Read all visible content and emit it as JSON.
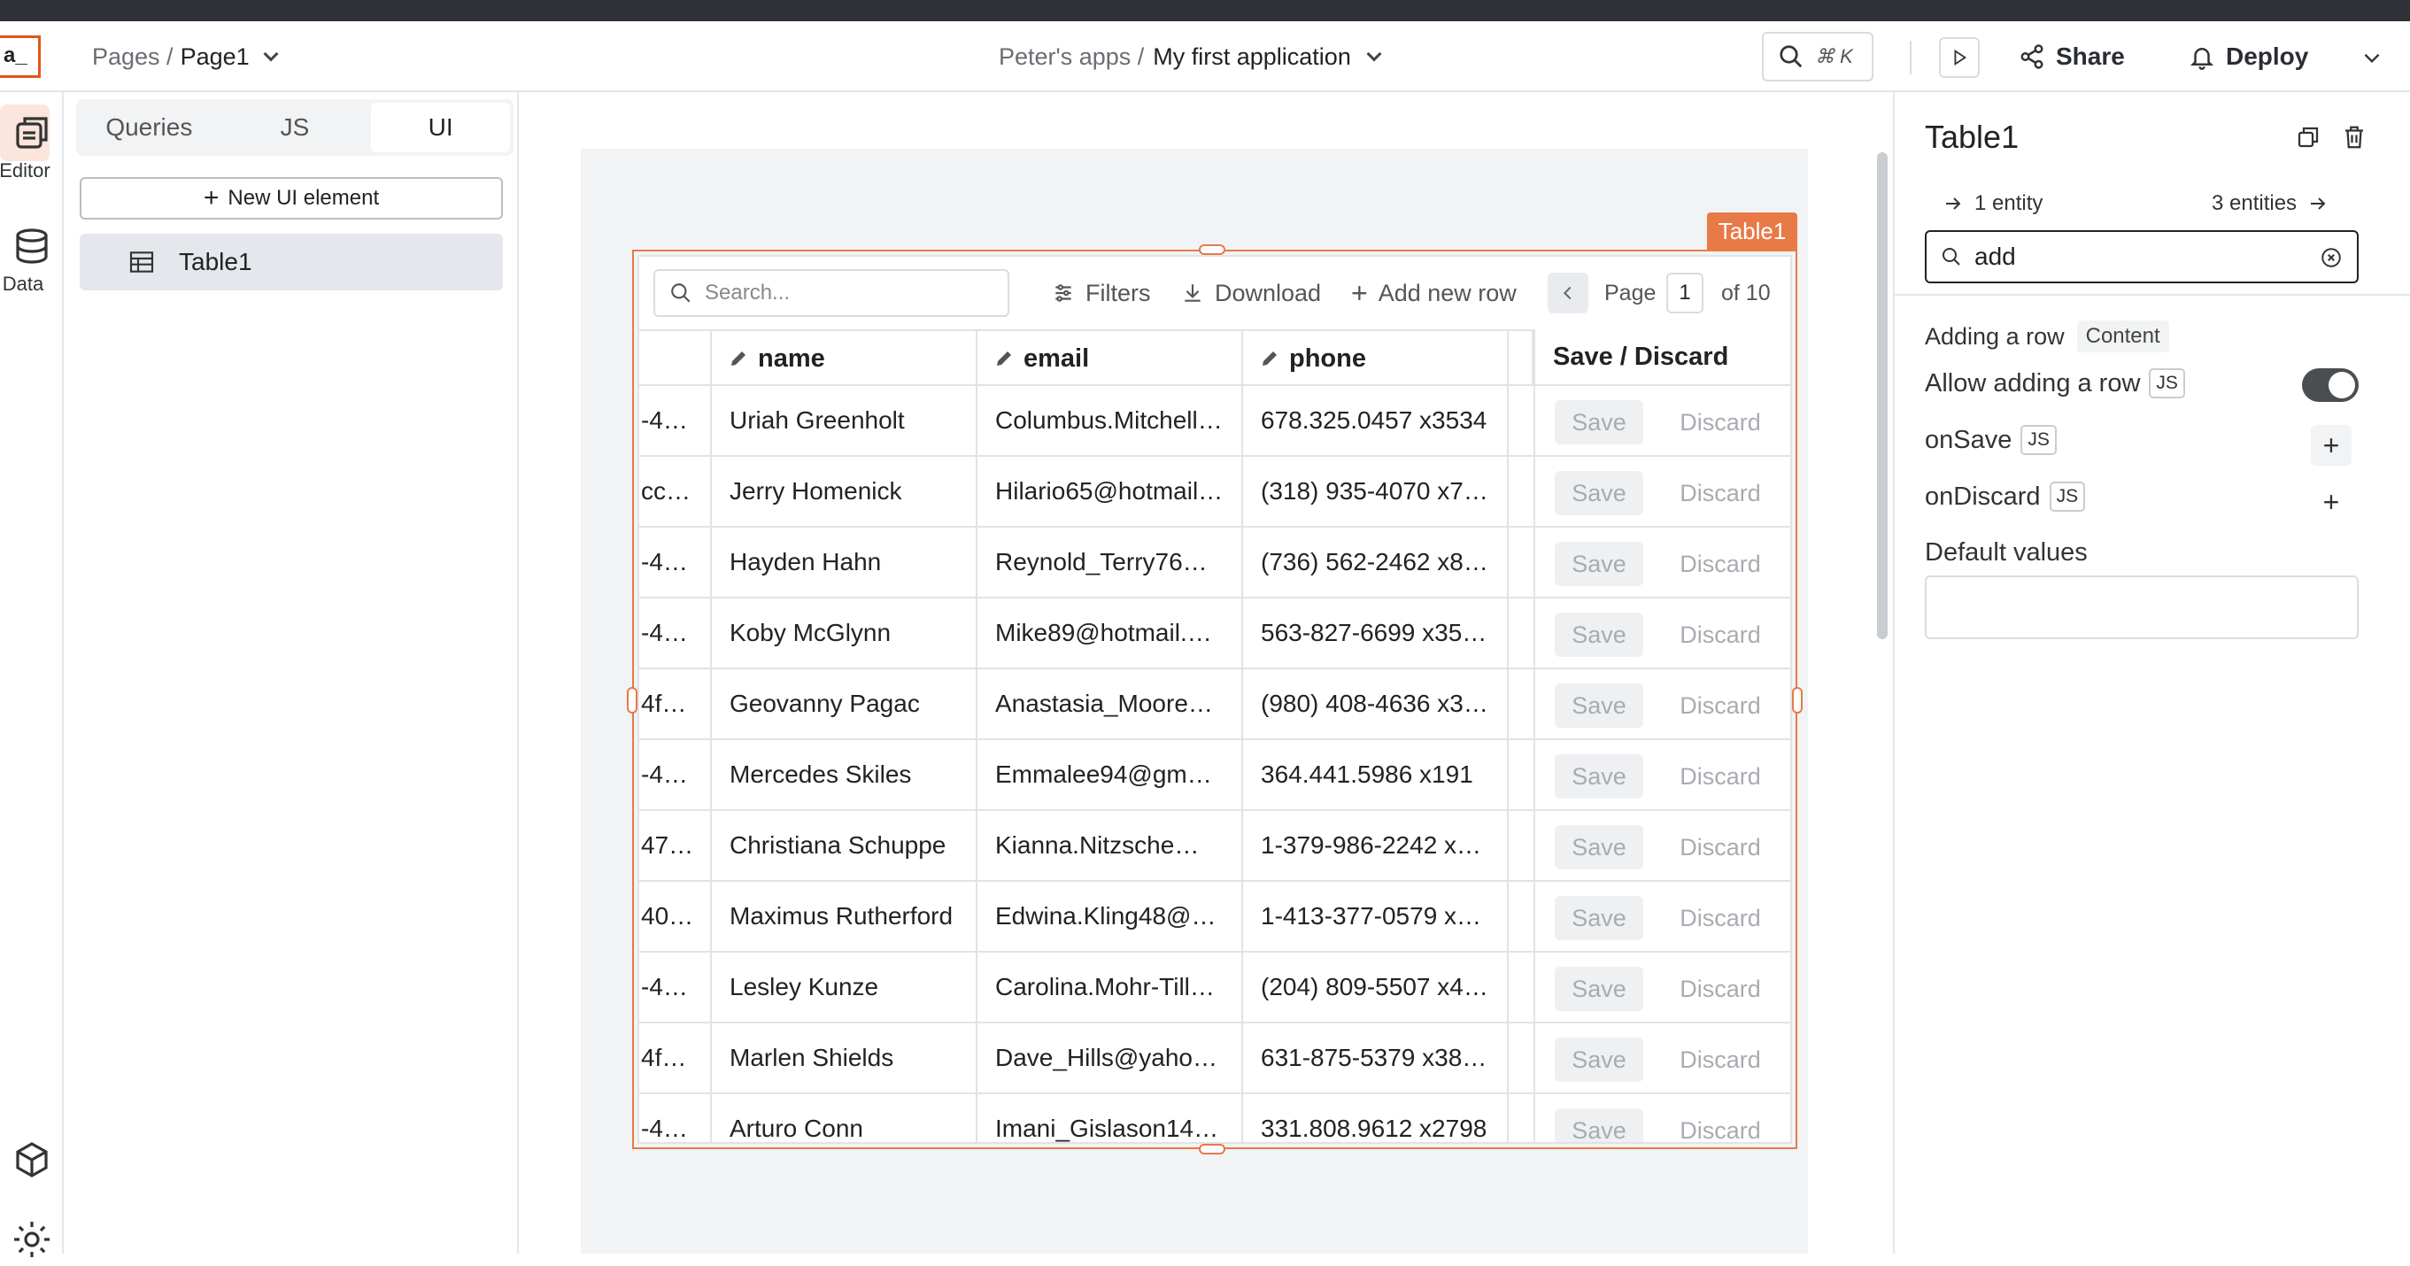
{
  "header": {
    "logo": "a_",
    "pages_label": "Pages /",
    "page_name": "Page1",
    "workspace": "Peter's apps /",
    "app_name": "My first application",
    "search_shortcut": "⌘ K",
    "share_label": "Share",
    "deploy_label": "Deploy"
  },
  "rail": {
    "editor_label": "Editor",
    "data_label": "Data"
  },
  "explorer": {
    "tabs": [
      {
        "label": "Queries"
      },
      {
        "label": "JS"
      },
      {
        "label": "UI"
      }
    ],
    "active_tab": "UI",
    "new_ui_label": "New UI element",
    "entity_name": "Table1"
  },
  "widget": {
    "label": "Table1"
  },
  "table": {
    "search_placeholder": "Search...",
    "filters_label": "Filters",
    "download_label": "Download",
    "add_row_label": "Add new row",
    "page_label": "Page",
    "page_number": "1",
    "page_of": "of 10",
    "columns": [
      "name",
      "email",
      "phone"
    ],
    "action_header": "Save / Discard",
    "save_label": "Save",
    "discard_label": "Discard",
    "rows": [
      {
        "id": "-4…",
        "name": "Uriah Greenholt",
        "email": "Columbus.Mitchell…",
        "phone": "678.325.0457 x3534"
      },
      {
        "id": "cc…",
        "name": "Jerry Homenick",
        "email": "Hilario65@hotmail…",
        "phone": "(318) 935-4070 x7…"
      },
      {
        "id": "-4…",
        "name": "Hayden Hahn",
        "email": "Reynold_Terry76…",
        "phone": "(736) 562-2462 x8…"
      },
      {
        "id": "-4…",
        "name": "Koby McGlynn",
        "email": "Mike89@hotmail.…",
        "phone": "563-827-6699 x35…"
      },
      {
        "id": "4f…",
        "name": "Geovanny Pagac",
        "email": "Anastasia_Moore…",
        "phone": "(980) 408-4636 x3…"
      },
      {
        "id": "-4…",
        "name": "Mercedes Skiles",
        "email": "Emmalee94@gm…",
        "phone": "364.441.5986 x191"
      },
      {
        "id": "47…",
        "name": "Christiana Schuppe",
        "email": "Kianna.Nitzsche…",
        "phone": "1-379-986-2242 x…"
      },
      {
        "id": "40…",
        "name": "Maximus Rutherford",
        "email": "Edwina.Kling48@…",
        "phone": "1-413-377-0579 x…"
      },
      {
        "id": "-4…",
        "name": "Lesley Kunze",
        "email": "Carolina.Mohr-Till…",
        "phone": "(204) 809-5507 x4…"
      },
      {
        "id": "4f…",
        "name": "Marlen Shields",
        "email": "Dave_Hills@yaho…",
        "phone": "631-875-5379 x38…"
      },
      {
        "id": "-4…",
        "name": "Arturo Conn",
        "email": "Imani_Gislason14…",
        "phone": "331.808.9612 x2798"
      }
    ]
  },
  "pane": {
    "title": "Table1",
    "prev_entity": "1 entity",
    "next_entity": "3 entities",
    "search_value": "add",
    "section_title": "Adding a row",
    "section_chip": "Content",
    "allow_adding_label": "Allow adding a row",
    "allow_adding_enabled": true,
    "on_save_label": "onSave",
    "on_discard_label": "onDiscard",
    "js_badge": "JS",
    "default_values_label": "Default values"
  },
  "colors": {
    "accent": "#e77a47",
    "brand": "#e15615"
  }
}
